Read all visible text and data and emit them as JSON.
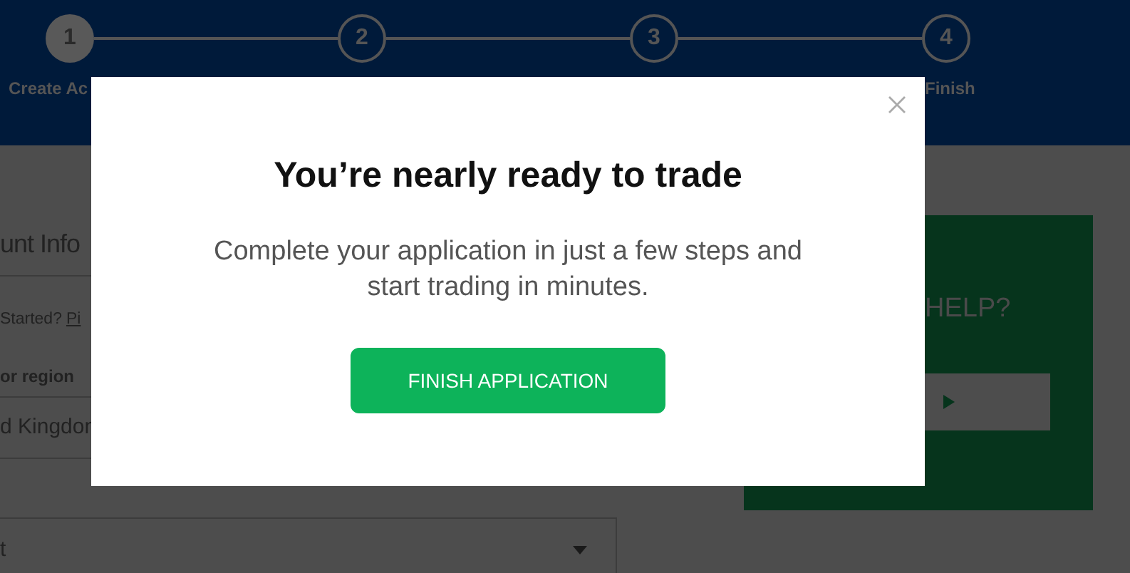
{
  "steps": [
    {
      "number": "1",
      "label": "Create Ac",
      "selected": true
    },
    {
      "number": "2",
      "selected": false
    },
    {
      "number": "3",
      "selected": false
    },
    {
      "number": "4",
      "label": "Finish",
      "selected": false
    }
  ],
  "form": {
    "heading": "unt Info",
    "prompt": "Started?",
    "prompt_link": "Pi",
    "field_label": "or region",
    "field_value": "d Kingdon",
    "select_value": "t"
  },
  "help_panel": {
    "title": "HELP?"
  },
  "modal": {
    "title": "You’re nearly ready to trade",
    "message": "Complete your application in just a few steps and start trading in minutes.",
    "button": "FINISH APPLICATION"
  }
}
